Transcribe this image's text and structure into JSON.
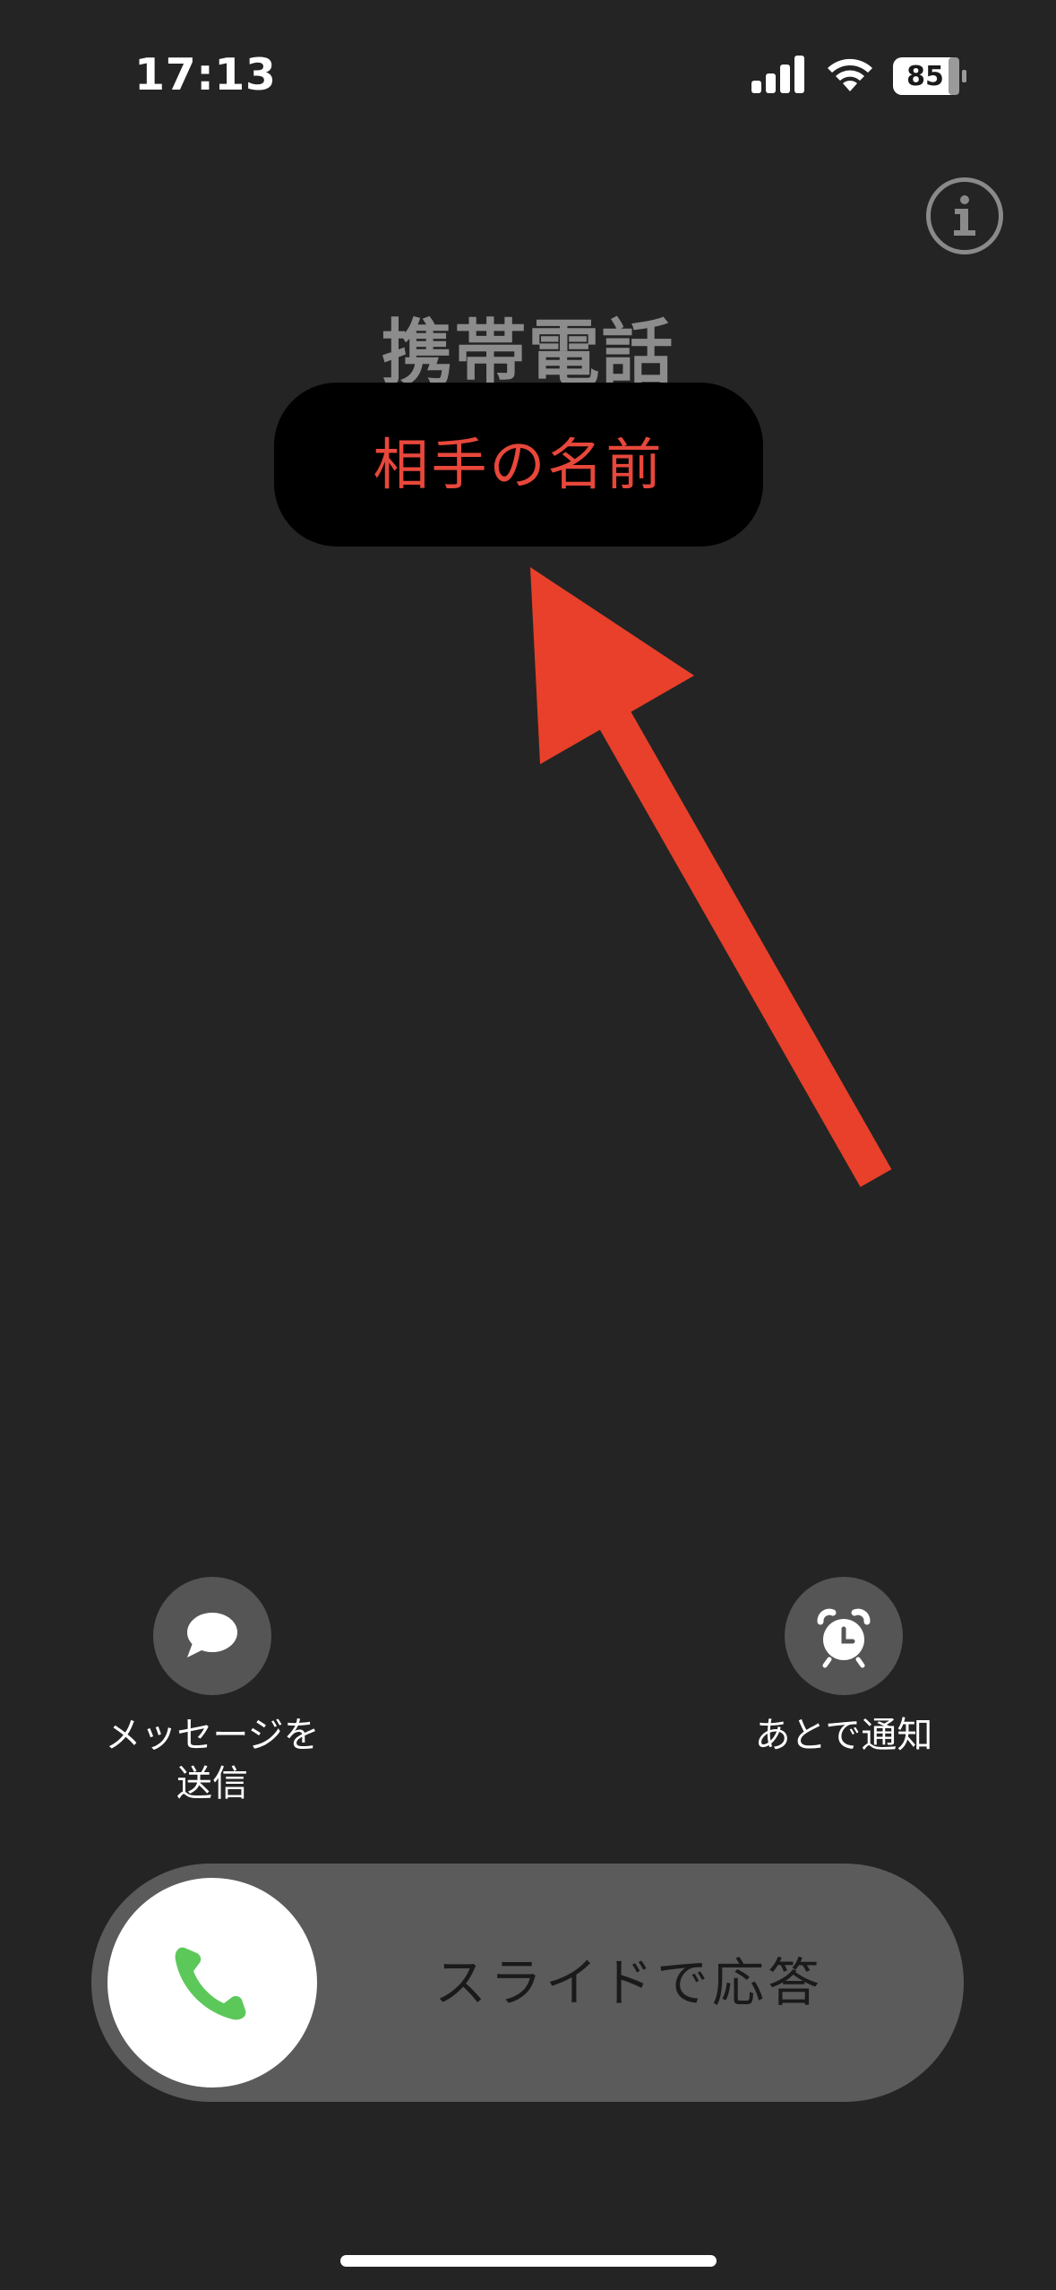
{
  "status_bar": {
    "time": "17:13",
    "battery_level": "85",
    "icons": [
      "signal-icon",
      "wifi-icon",
      "battery-icon"
    ]
  },
  "call": {
    "label": "携帯電話",
    "name_overlay": "相手の名前"
  },
  "actions": {
    "message": {
      "icon": "message-bubble-icon",
      "label_line1": "メッセージを",
      "label_line2": "送信"
    },
    "remind": {
      "icon": "alarm-clock-icon",
      "label": "あとで通知"
    }
  },
  "slider": {
    "icon": "phone-icon",
    "label": "スライドで応答"
  },
  "colors": {
    "background": "#242424",
    "accent_red": "#e8473b",
    "phone_green": "#5cc85a",
    "label_gray": "#8c8c8c"
  }
}
